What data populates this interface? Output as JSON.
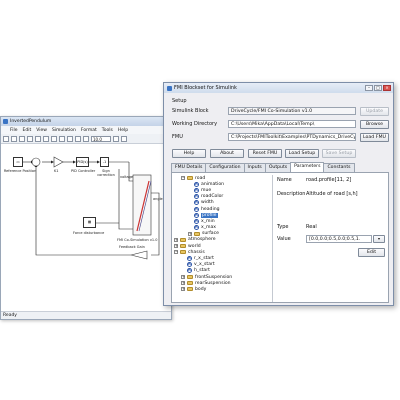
{
  "simulink": {
    "title": "InvertedPendulum",
    "menu": [
      "File",
      "Edit",
      "View",
      "Simulation",
      "Format",
      "Tools",
      "Help"
    ],
    "stop_time": "10.0",
    "status": "Ready",
    "blocks": {
      "reference": "Reference Position",
      "k1": "K1",
      "pid": "PID(s)",
      "pid_label": "PID Controller",
      "sign_label": "Sign correction",
      "force_label": "Force disturbance",
      "feedback": "Feedback Gain",
      "fmu_label": "FMI Co-Simulation v1.0",
      "voltage": "voltage",
      "angle": "angle"
    }
  },
  "fmi": {
    "title": "FMI Blockset for Simulink",
    "setup_label": "Setup",
    "simulink_block_label": "Simulink Block",
    "simulink_block_value": "DriveCycle/FMI Co-Simulation v1.0",
    "working_dir_label": "Working Directory",
    "working_dir_value": "C:\\Users\\Mika\\AppData\\Local\\Temp\\",
    "fmu_label": "FMU",
    "fmu_value": "C:\\Projects\\FMIToolkit\\Examples\\PTDynamics_DriveCycle\\PT",
    "buttons": {
      "update": "Update",
      "browse": "Browse",
      "load_fmu": "Load FMU",
      "help": "Help",
      "about": "About",
      "reset_fmu": "Reset FMU",
      "load_setup": "Load Setup",
      "save_setup": "Save Setup",
      "edit": "Edit"
    },
    "tabs": [
      "FMU Details",
      "Configuration",
      "Inputs",
      "Outputs",
      "Parameters",
      "Constants"
    ],
    "active_tab": "Parameters",
    "tree": [
      {
        "label": "road",
        "kind": "folder",
        "indent": 1,
        "expander": "−"
      },
      {
        "label": "animation",
        "kind": "var",
        "indent": 2
      },
      {
        "label": "mue",
        "kind": "var",
        "indent": 2
      },
      {
        "label": "roadColor",
        "kind": "var",
        "indent": 2
      },
      {
        "label": "width",
        "kind": "var",
        "indent": 2
      },
      {
        "label": "heading",
        "kind": "var",
        "indent": 2
      },
      {
        "label": "profile",
        "kind": "var",
        "indent": 2,
        "selected": true
      },
      {
        "label": "x_min",
        "kind": "var",
        "indent": 2
      },
      {
        "label": "x_max",
        "kind": "var",
        "indent": 2
      },
      {
        "label": "surface",
        "kind": "folder",
        "indent": 2,
        "expander": "+"
      },
      {
        "label": "atmosphere",
        "kind": "folder",
        "indent": 0,
        "expander": "+"
      },
      {
        "label": "world",
        "kind": "folder",
        "indent": 0,
        "expander": "+"
      },
      {
        "label": "chassis",
        "kind": "folder",
        "indent": 0,
        "expander": "−"
      },
      {
        "label": "r_x_start",
        "kind": "var",
        "indent": 1
      },
      {
        "label": "v_x_start",
        "kind": "var",
        "indent": 1
      },
      {
        "label": "h_start",
        "kind": "var",
        "indent": 1
      },
      {
        "label": "frontSuspension",
        "kind": "folder",
        "indent": 1,
        "expander": "+"
      },
      {
        "label": "rearSuspension",
        "kind": "folder",
        "indent": 1,
        "expander": "+"
      },
      {
        "label": "body",
        "kind": "folder",
        "indent": 1,
        "expander": "+"
      }
    ],
    "props": {
      "name_label": "Name",
      "name_value": "road.profile[11, 2]",
      "description_label": "Description",
      "description_value": "Altitude of road [s,h]",
      "type_label": "Type",
      "type_value": "Real",
      "value_label": "Value",
      "value_value": "[0.0,0.0;0.5,0.0;0.5,1."
    }
  },
  "colors": {
    "accent": "#3a74c4",
    "folder": "#e8c661",
    "var_ring": "#2c55a8"
  }
}
